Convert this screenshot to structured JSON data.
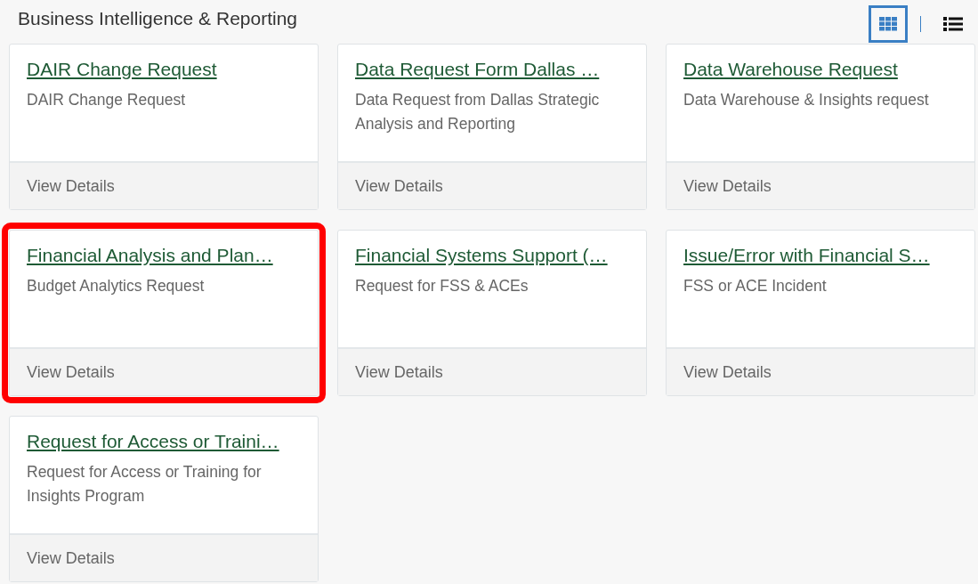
{
  "header": {
    "title": "Business Intelligence & Reporting"
  },
  "view_toggle": [
    {
      "kind": "grid",
      "selected": true
    },
    {
      "kind": "list",
      "selected": false
    }
  ],
  "cards": [
    {
      "title": "DAIR Change Request",
      "description": "DAIR Change Request",
      "action": "View Details",
      "highlighted": false
    },
    {
      "title": "Data Request Form Dallas …",
      "description": "Data Request from Dallas Strategic Analysis and Reporting",
      "action": "View Details",
      "highlighted": false
    },
    {
      "title": "Data Warehouse Request",
      "description": "Data Warehouse & Insights request",
      "action": "View Details",
      "highlighted": false
    },
    {
      "title": "Financial Analysis and Plan…",
      "description": "Budget Analytics Request",
      "action": "View Details",
      "highlighted": true
    },
    {
      "title": "Financial Systems Support (…",
      "description": "Request for FSS & ACEs",
      "action": "View Details",
      "highlighted": false
    },
    {
      "title": "Issue/Error with Financial S…",
      "description": "FSS or ACE Incident",
      "action": "View Details",
      "highlighted": false
    },
    {
      "title": "Request for Access or Traini…",
      "description": "Request for Access or Training for Insights Program",
      "action": "View Details",
      "highlighted": false
    }
  ]
}
